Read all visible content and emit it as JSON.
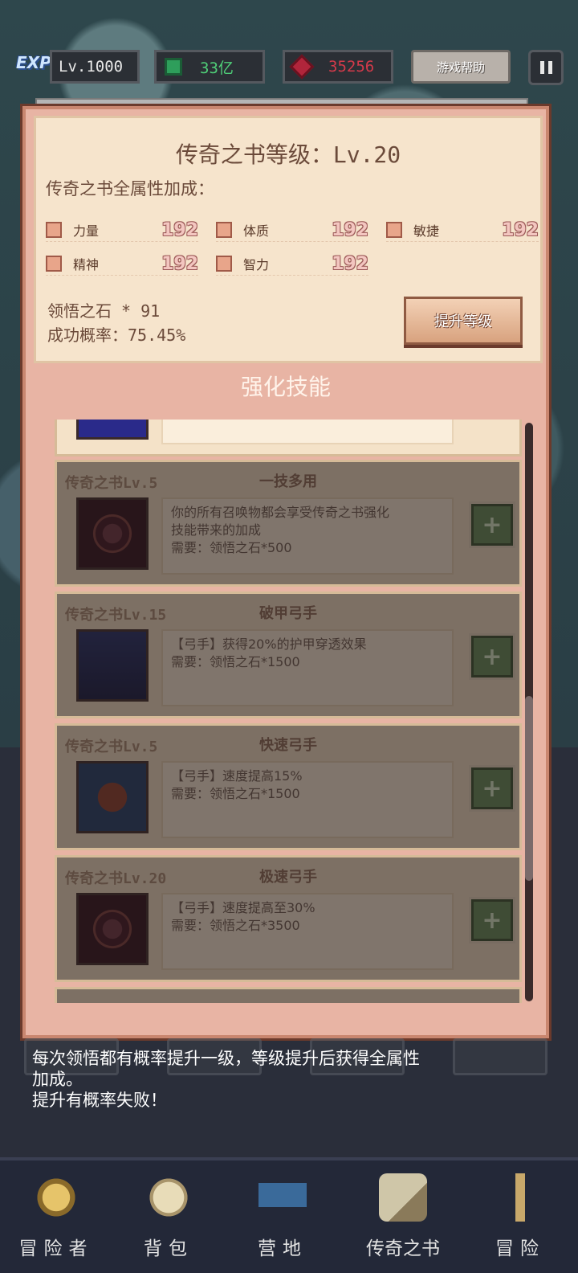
{
  "hud": {
    "exp_label": "EXP",
    "level": "Lv.1000",
    "gems": "33亿",
    "rubies": "35256",
    "help_label": "游戏帮助"
  },
  "book_panel": {
    "title": "传奇之书等级：Lv.20",
    "subtitle": "传奇之书全属性加成：",
    "stats": [
      {
        "label": "力量",
        "value": "192",
        "icon": "strength-icon"
      },
      {
        "label": "体质",
        "value": "192",
        "icon": "heart-icon"
      },
      {
        "label": "敏捷",
        "value": "192",
        "icon": "boot-icon"
      },
      {
        "label": "精神",
        "value": "192",
        "icon": "spirit-icon"
      },
      {
        "label": "智力",
        "value": "192",
        "icon": "brain-icon"
      }
    ],
    "stone_count": "领悟之石 * 91",
    "success_rate": "成功概率：75.45%",
    "upgrade_label": "提升等级"
  },
  "section_title": "强化技能",
  "skills": [
    {
      "req": "传奇之书Lv.5",
      "name": "一技多用",
      "desc1": "你的所有召唤物都会享受传奇之书强化",
      "desc2": "技能带来的加成",
      "desc3": "需要：领悟之石*500"
    },
    {
      "req": "传奇之书Lv.15",
      "name": "破甲弓手",
      "desc1": "【弓手】获得20%的护甲穿透效果",
      "desc2": "需要：领悟之石*1500",
      "desc3": ""
    },
    {
      "req": "传奇之书Lv.5",
      "name": "快速弓手",
      "desc1": "【弓手】速度提高15%",
      "desc2": "需要：领悟之石*1500",
      "desc3": ""
    },
    {
      "req": "传奇之书Lv.20",
      "name": "极速弓手",
      "desc1": "【弓手】速度提高至30%",
      "desc2": "需要：领悟之石*3500",
      "desc3": ""
    }
  ],
  "footer": {
    "line1": "每次领悟都有概率提升一级，等级提升后获得全属性",
    "line2": "加成。",
    "line3": "提升有概率失败！"
  },
  "nav": [
    {
      "label": "冒险者",
      "icon": "adventurer-icon"
    },
    {
      "label": "背包",
      "icon": "backpack-icon"
    },
    {
      "label": "营地",
      "icon": "camp-icon"
    },
    {
      "label": "传奇之书",
      "icon": "legend-book-icon"
    },
    {
      "label": "冒险",
      "icon": "sword-icon"
    }
  ]
}
